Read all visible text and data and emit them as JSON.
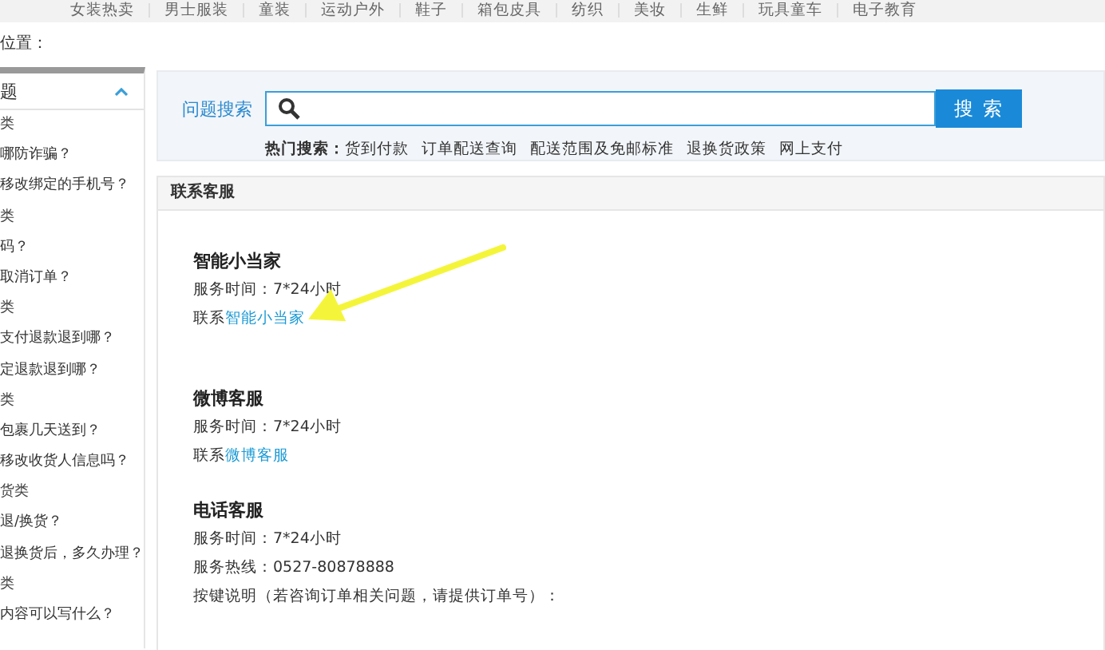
{
  "top_nav": [
    "女装热卖",
    "男士服装",
    "童装",
    "运动户外",
    "鞋子",
    "箱包皮具",
    "纺织",
    "美妆",
    "生鲜",
    "玩具童车",
    "电子教育"
  ],
  "breadcrumb": "位置：",
  "sidebar": {
    "title": "题",
    "expanded": true,
    "items": [
      {
        "kind": "category",
        "text": "类"
      },
      {
        "kind": "question",
        "text": "哪防诈骗？"
      },
      {
        "kind": "question",
        "text": "移改绑定的手机号？"
      },
      {
        "kind": "category",
        "text": "类"
      },
      {
        "kind": "question",
        "text": "码？"
      },
      {
        "kind": "question",
        "text": "取消订单？"
      },
      {
        "kind": "category",
        "text": "类"
      },
      {
        "kind": "question",
        "text": "支付退款退到哪？"
      },
      {
        "kind": "question",
        "text": "定退款退到哪？"
      },
      {
        "kind": "category",
        "text": "类"
      },
      {
        "kind": "question",
        "text": "包裹几天送到？"
      },
      {
        "kind": "question",
        "text": "移改收货人信息吗？"
      },
      {
        "kind": "category",
        "text": "货类"
      },
      {
        "kind": "question",
        "text": "退/换货？"
      },
      {
        "kind": "question",
        "text": "退换货后，多久办理？"
      },
      {
        "kind": "category",
        "text": "类"
      },
      {
        "kind": "question",
        "text": "内容可以写什么？"
      }
    ]
  },
  "search": {
    "label": "问题搜索",
    "button": "搜 索",
    "hot_label": "热门搜索：",
    "hot": [
      "货到付款",
      "订单配送查询",
      "配送范围及免邮标准",
      "退换货政策",
      "网上支付"
    ]
  },
  "contact": {
    "title": "联系客服",
    "blocks": [
      {
        "name": "智能小当家",
        "lines": [
          "服务时间：7*24小时"
        ],
        "link_prefix": "联系",
        "link": "智能小当家",
        "highlighted": true
      },
      {
        "name": "微博客服",
        "lines": [
          "服务时间：7*24小时"
        ],
        "link_prefix": "联系",
        "link": "微博客服",
        "highlighted": false
      },
      {
        "name": "电话客服",
        "lines": [
          "服务时间：7*24小时",
          "服务热线：0527-80878888",
          "按键说明（若咨询订单相关问题，请提供订单号）："
        ],
        "highlighted": false
      }
    ]
  }
}
